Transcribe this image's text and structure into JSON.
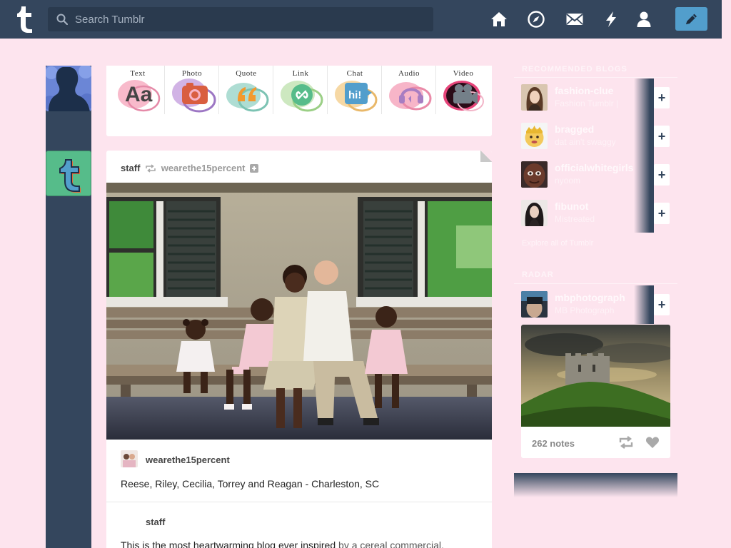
{
  "search": {
    "placeholder": "Search Tumblr"
  },
  "nav": {
    "icons": [
      "home-icon",
      "explore-compass-icon",
      "inbox-envelope-icon",
      "activity-lightning-icon",
      "account-person-icon"
    ],
    "compose_icon": "pencil-icon"
  },
  "post_types": [
    {
      "label": "Text",
      "icon": "text-aa-icon",
      "color": "#444444"
    },
    {
      "label": "Photo",
      "icon": "camera-icon",
      "color": "#d95e40"
    },
    {
      "label": "Quote",
      "icon": "quote-icon",
      "color": "#f2992e"
    },
    {
      "label": "Link",
      "icon": "link-icon",
      "color": "#56bc8a"
    },
    {
      "label": "Chat",
      "icon": "chat-hi-icon",
      "color": "#529ecc"
    },
    {
      "label": "Audio",
      "icon": "headphones-icon",
      "color": "#a77dc2"
    },
    {
      "label": "Video",
      "icon": "video-camera-icon",
      "color": "#748089"
    }
  ],
  "post": {
    "reblogger": "staff",
    "source": "wearethe15percent",
    "caption": "Reese, Riley, Cecilia, Torrey and Reagan - Charleston, SC",
    "source_author": "wearethe15percent",
    "reblogger_author": "staff",
    "body_text": "This is the most heartwarming blog ever inspired ",
    "body_link": "by a cereal commercial."
  },
  "sidebar": {
    "recommended_title": "RECOMMENDED BLOGS",
    "recommended": [
      {
        "name": "fashion-clue",
        "subtitle": "Fashion Tumblr |",
        "follow": "+"
      },
      {
        "name": "bragged",
        "subtitle": "dat ain't swaggy",
        "follow": "+"
      },
      {
        "name": "officialwhitegirls",
        "subtitle": "nyoom",
        "follow": "+"
      },
      {
        "name": "fibunot",
        "subtitle": "Mistreated",
        "follow": "+"
      }
    ],
    "explore_link": "Explore all of Tumblr",
    "radar_title": "RADAR",
    "radar": {
      "name": "mbphotograph",
      "subtitle": "MB Photograph",
      "follow": "+",
      "notes": "262 notes"
    }
  }
}
